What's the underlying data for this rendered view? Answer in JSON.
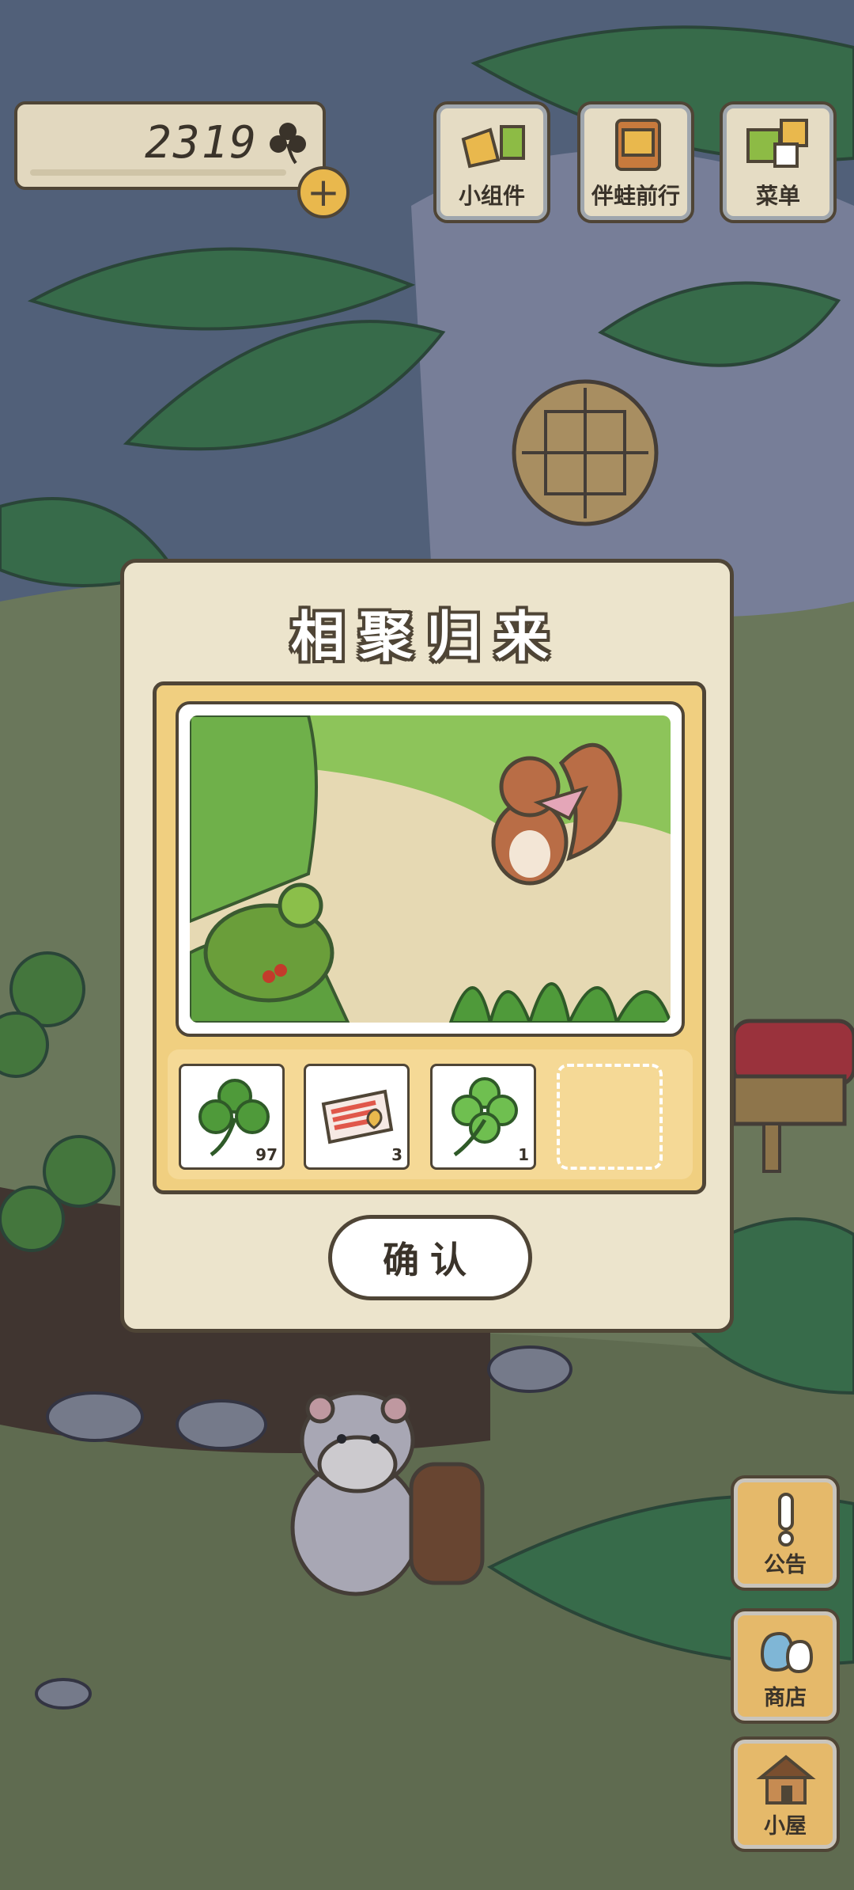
{
  "hud": {
    "clover_count": "2319",
    "add_label": "+"
  },
  "top_buttons": [
    {
      "label": "小组件",
      "icon": "widget-icon"
    },
    {
      "label": "伴蛙前行",
      "icon": "album-icon"
    },
    {
      "label": "菜单",
      "icon": "menu-icon"
    }
  ],
  "side_buttons": [
    {
      "label": "公告",
      "icon": "notice-icon"
    },
    {
      "label": "商店",
      "icon": "shop-icon"
    },
    {
      "label": "小屋",
      "icon": "house-icon"
    }
  ],
  "dialog": {
    "title": "相聚归来",
    "photo_icon": "frog-and-squirrel-photo",
    "items": [
      {
        "icon": "three-leaf-clover-icon",
        "count": "97"
      },
      {
        "icon": "ticket-icon",
        "count": "3"
      },
      {
        "icon": "four-leaf-clover-icon",
        "count": "1"
      },
      {
        "icon": "empty-slot",
        "count": ""
      }
    ],
    "confirm_label": "确认"
  },
  "colors": {
    "outline": "#4f4536",
    "panel": "#f0cf80",
    "dialog_bg": "#ece4cc",
    "accent": "#e9b84d"
  }
}
